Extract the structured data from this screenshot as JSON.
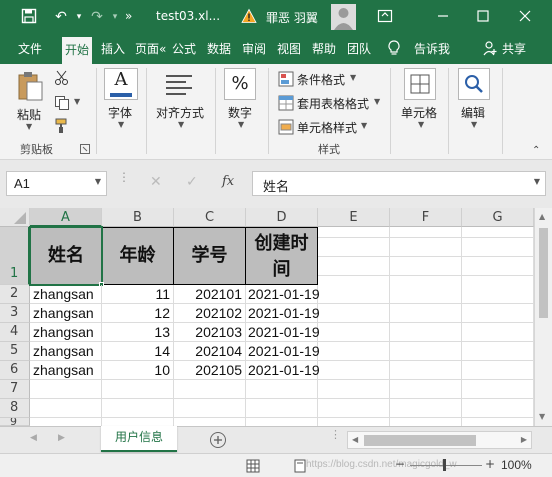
{
  "titlebar": {
    "filename": "test03.xl...",
    "user": "罪恶 羽翼",
    "qat_more": "»"
  },
  "tabs": [
    {
      "label": "文件"
    },
    {
      "label": "开始"
    },
    {
      "label": "插入"
    },
    {
      "label": "页面«"
    },
    {
      "label": "公式"
    },
    {
      "label": "数据"
    },
    {
      "label": "审阅"
    },
    {
      "label": "视图"
    },
    {
      "label": "帮助"
    },
    {
      "label": "团队"
    },
    {
      "label": "告诉我"
    },
    {
      "label": "共享"
    }
  ],
  "ribbon": {
    "paste": "粘贴",
    "clipboard_group": "剪贴板",
    "font": "字体",
    "alignment": "对齐方式",
    "number": "数字",
    "percent_symbol": "%",
    "conditional_format": "条件格式",
    "table_format": "套用表格格式",
    "cell_style": "单元格样式",
    "styles_group": "样式",
    "cells": "单元格",
    "editing": "编辑",
    "font_glyph": "A"
  },
  "formula_bar": {
    "name_box": "A1",
    "fx": "fx",
    "content": "姓名"
  },
  "columns": [
    "A",
    "B",
    "C",
    "D",
    "E",
    "F",
    "G"
  ],
  "rows": [
    "1",
    "2",
    "3",
    "4",
    "5",
    "6",
    "7",
    "8",
    "9"
  ],
  "header_row": [
    "姓名",
    "年龄",
    "学号",
    "创建时间"
  ],
  "data_rows": [
    [
      "zhangsan",
      "11",
      "202101",
      "2021-01-19"
    ],
    [
      "zhangsan",
      "12",
      "202102",
      "2021-01-19"
    ],
    [
      "zhangsan",
      "13",
      "202103",
      "2021-01-19"
    ],
    [
      "zhangsan",
      "14",
      "202104",
      "2021-01-19"
    ],
    [
      "zhangsan",
      "10",
      "202105",
      "2021-01-19"
    ]
  ],
  "sheet_tab": "用户信息",
  "status": {
    "zoom": "100%",
    "watermark": "https://blog.csdn.net/magicgold_w"
  }
}
